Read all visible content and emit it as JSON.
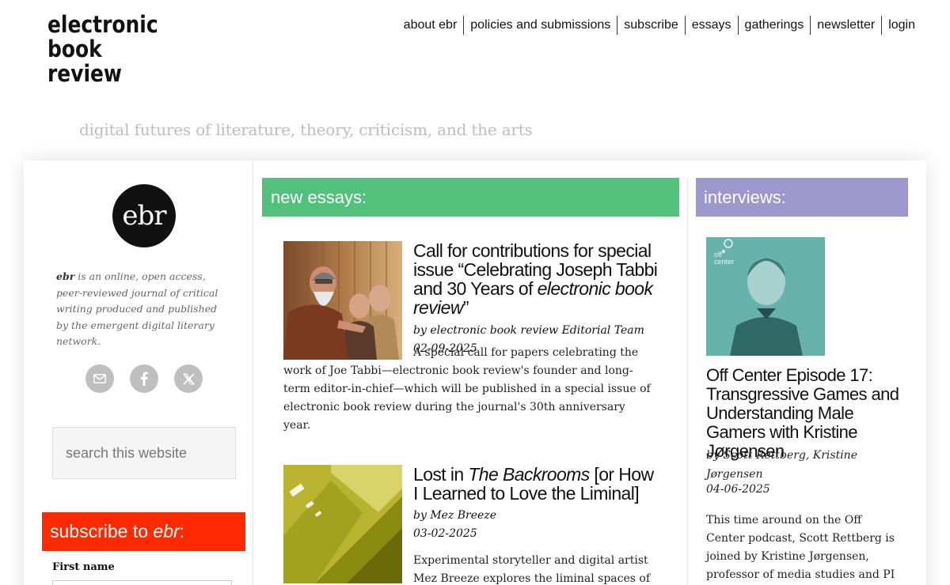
{
  "site": {
    "logo_lines": [
      "electronic",
      "book",
      "review"
    ],
    "tagline": "digital futures of literature, theory, criticism, and the arts"
  },
  "nav": [
    {
      "label": "about ebr"
    },
    {
      "label": "policies and submissions"
    },
    {
      "label": "subscribe"
    },
    {
      "label": "essays"
    },
    {
      "label": "gatherings"
    },
    {
      "label": "newsletter"
    },
    {
      "label": "login"
    }
  ],
  "sidebar": {
    "badge": "ebr",
    "about_strong": "ebr",
    "about_rest": " is an online, open access, peer-reviewed journal of critical writing produced and published by the emergent digital literary network.",
    "social_icons": [
      "email-icon",
      "facebook-icon",
      "x-icon"
    ],
    "search_placeholder": "search this website",
    "subscribe_prefix": "subscribe to ",
    "subscribe_brand": "ebr",
    "subscribe_suffix": ":",
    "first_name_label": "First name"
  },
  "essays": {
    "heading": "new essays:",
    "items": [
      {
        "title_before": "Call for contributions for special issue “Celebrating Joseph Tabbi and 30 Years of ",
        "title_em": "electronic book review",
        "title_after": "”",
        "byline": "by electronic book review Editorial Team",
        "date": "02-09-2025",
        "excerpt": "A special call for papers celebrating the work of Joe Tabbi—electronic book review's founder and long-term editor-in-chief—which will be published in a special issue of electronic book review during the journal's 30th anniversary year."
      },
      {
        "title_before": "Lost in ",
        "title_em": "The Backrooms",
        "title_after": " [or How I Learned to Love the Liminal]",
        "byline": "by Mez Breeze",
        "date": "03-02-2025",
        "excerpt": "Experimental storyteller and digital artist Mez Breeze explores the liminal spaces of The"
      }
    ]
  },
  "interviews": {
    "heading": "interviews:",
    "thumb_label": "off center",
    "title": "Off Center Episode 17: Transgressive Games and Understanding Male Gamers with Kristine Jørgensen",
    "byline": "by Scott Rettberg, Kristine Jørgensen",
    "date": "04-06-2025",
    "excerpt": "This time around on the Off Center podcast, Scott Rettberg is joined by Kristine Jørgensen, professor of media studies and PI at the Center"
  },
  "colors": {
    "essays_accent": "#52c17b",
    "interviews_accent": "#9d98cc",
    "subscribe_accent": "#ff2a00"
  }
}
